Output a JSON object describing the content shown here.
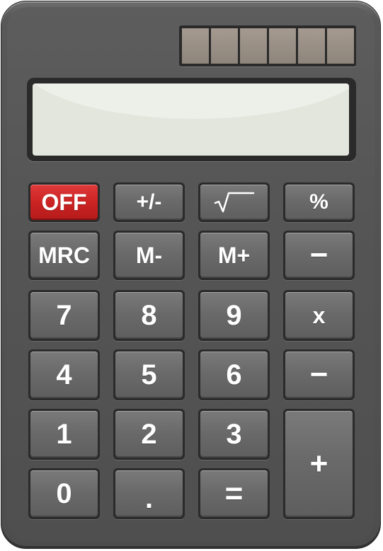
{
  "display": {
    "value": ""
  },
  "solar_panel": {
    "cells": 6
  },
  "keys": {
    "off": "OFF",
    "plus_minus": "+/-",
    "percent": "%",
    "mrc": "MRC",
    "m_minus": "M-",
    "m_plus": "M+",
    "divide": "−",
    "seven": "7",
    "eight": "8",
    "nine": "9",
    "multiply": "x",
    "four": "4",
    "five": "5",
    "six": "6",
    "minus": "−",
    "one": "1",
    "two": "2",
    "three": "3",
    "plus": "+",
    "zero": "0",
    "decimal": ".",
    "equals": "="
  },
  "colors": {
    "body": "#555555",
    "key": "#6a6a6a",
    "off_key": "#cc2323",
    "screen": "#e3e6dd",
    "solar": "#9a9086"
  }
}
